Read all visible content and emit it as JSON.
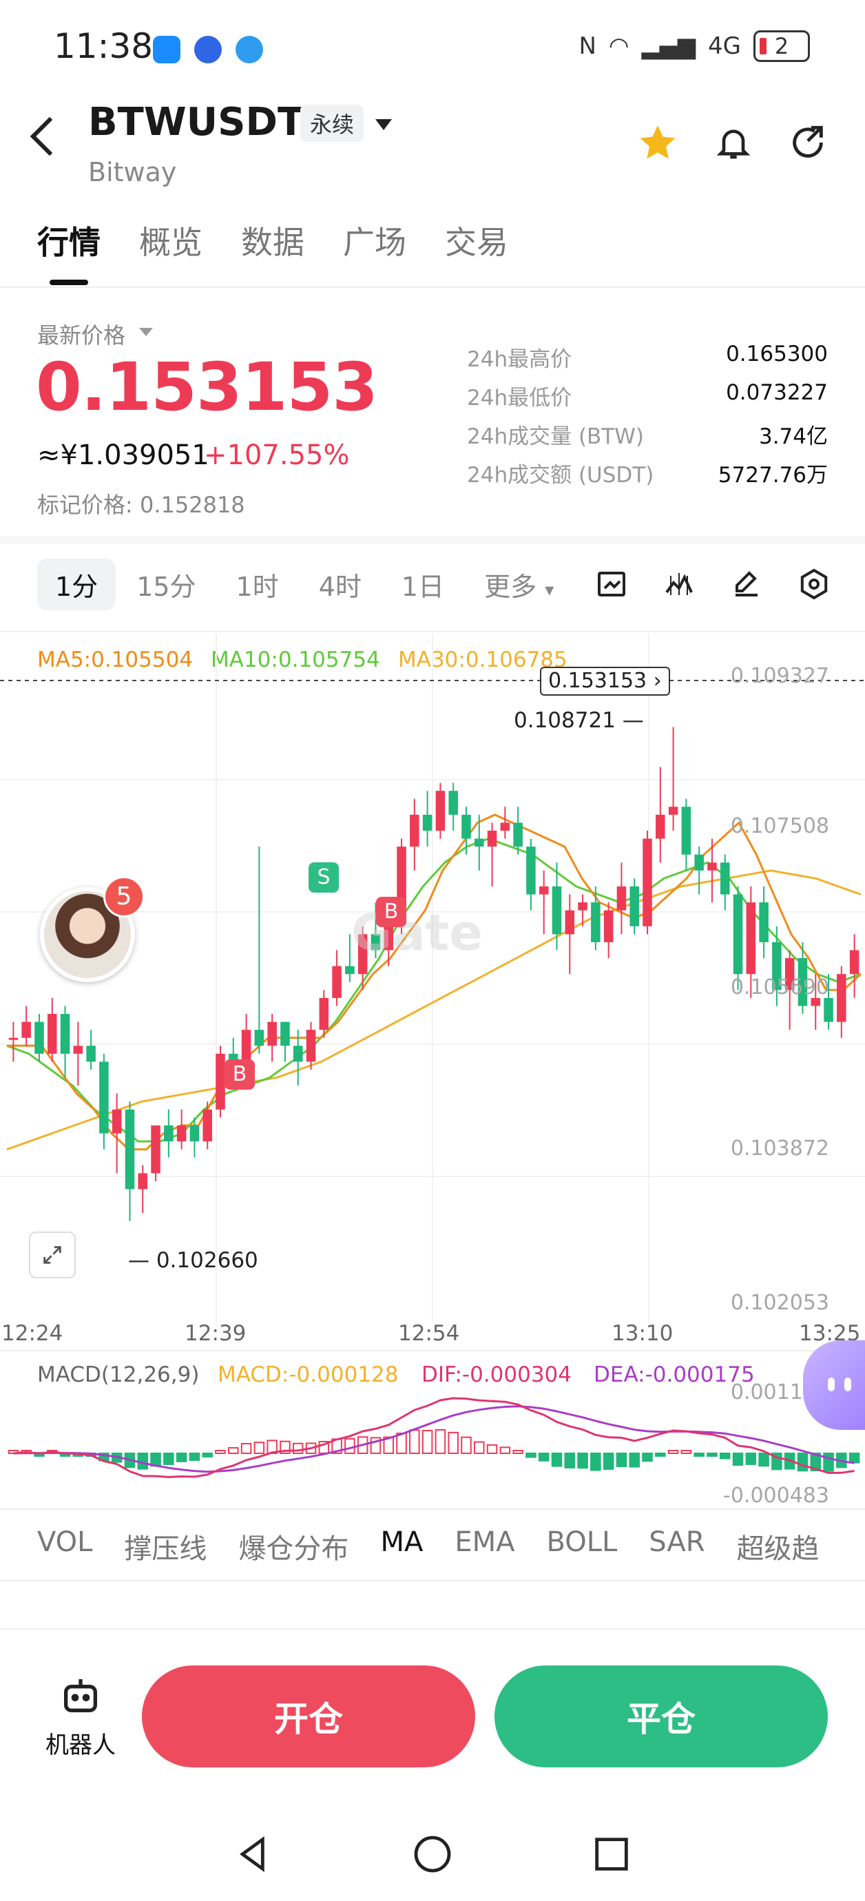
{
  "status_bar": {
    "time": "11:38",
    "battery": "2",
    "network": "4G"
  },
  "header": {
    "symbol": "BTWUSDT",
    "contract_type": "永续",
    "exchange": "Bitway",
    "favorite": true
  },
  "tabs": [
    {
      "label": "行情",
      "active": true
    },
    {
      "label": "概览"
    },
    {
      "label": "数据"
    },
    {
      "label": "广场"
    },
    {
      "label": "交易"
    }
  ],
  "price": {
    "latest_label": "最新价格",
    "last": "0.153153",
    "cny": "≈¥1.039051",
    "change": "+107.55%",
    "mark_label": "标记价格",
    "mark": "0.152818"
  },
  "stats": [
    {
      "label": "24h最高价",
      "value": "0.165300"
    },
    {
      "label": "24h最低价",
      "value": "0.073227"
    },
    {
      "label": "24h成交量 (BTW)",
      "value": "3.74亿"
    },
    {
      "label": "24h成交额 (USDT)",
      "value": "5727.76万"
    }
  ],
  "timeframes": [
    {
      "label": "1分",
      "active": true
    },
    {
      "label": "15分"
    },
    {
      "label": "1时"
    },
    {
      "label": "4时"
    },
    {
      "label": "1日"
    },
    {
      "label": "更多"
    }
  ],
  "colors": {
    "up": "#ee3b55",
    "down": "#1fb77a",
    "ma5": "#f08c18",
    "ma10": "#5ecb3a",
    "ma30": "#f2b12c",
    "dif": "#e0356f",
    "dea": "#a93cc8",
    "macd": "#f2b12c"
  },
  "chart_data": {
    "type": "candlestick",
    "legend": {
      "ma5": "MA5:0.105504",
      "ma10": "MA10:0.105754",
      "ma30": "MA30:0.106785"
    },
    "y_ticks": [
      "0.109327",
      "0.107508",
      "0.105690",
      "0.103872",
      "0.102053"
    ],
    "x_ticks": [
      "12:24",
      "12:39",
      "12:54",
      "13:10",
      "13:25"
    ],
    "ylim": [
      0.1016,
      0.1099
    ],
    "last_price_pill": "0.153153",
    "high_label": "0.108721",
    "low_label": "0.102660",
    "markers": [
      {
        "type": "S"
      },
      {
        "type": "B"
      },
      {
        "type": "B"
      }
    ],
    "candles": [
      [
        0.105,
        0.1052,
        0.1047,
        0.105
      ],
      [
        0.105,
        0.1054,
        0.1049,
        0.1052
      ],
      [
        0.1052,
        0.1053,
        0.1047,
        0.1048
      ],
      [
        0.1048,
        0.1055,
        0.1047,
        0.1053
      ],
      [
        0.1053,
        0.1054,
        0.1045,
        0.1048
      ],
      [
        0.1048,
        0.1052,
        0.1044,
        0.1049
      ],
      [
        0.1049,
        0.1051,
        0.1046,
        0.1047
      ],
      [
        0.1047,
        0.1048,
        0.1036,
        0.1038
      ],
      [
        0.1038,
        0.1043,
        0.1033,
        0.1041
      ],
      [
        0.1041,
        0.1042,
        0.1027,
        0.1031
      ],
      [
        0.1031,
        0.1034,
        0.1028,
        0.1033
      ],
      [
        0.1033,
        0.1039,
        0.1032,
        0.1039
      ],
      [
        0.1039,
        0.1041,
        0.1035,
        0.1037
      ],
      [
        0.1037,
        0.1041,
        0.1036,
        0.1039
      ],
      [
        0.1039,
        0.104,
        0.1035,
        0.1037
      ],
      [
        0.1037,
        0.1042,
        0.1036,
        0.1041
      ],
      [
        0.1041,
        0.1049,
        0.104,
        0.1048
      ],
      [
        0.1048,
        0.105,
        0.1044,
        0.1046
      ],
      [
        0.1046,
        0.1053,
        0.1045,
        0.1051
      ],
      [
        0.1051,
        0.1074,
        0.1048,
        0.1049
      ],
      [
        0.1049,
        0.1053,
        0.1047,
        0.1052
      ],
      [
        0.1052,
        0.1052,
        0.1047,
        0.1049
      ],
      [
        0.1049,
        0.1051,
        0.1044,
        0.1047
      ],
      [
        0.1047,
        0.1052,
        0.1046,
        0.1051
      ],
      [
        0.1051,
        0.1056,
        0.105,
        0.1055
      ],
      [
        0.1055,
        0.1061,
        0.1054,
        0.1059
      ],
      [
        0.1059,
        0.1063,
        0.1057,
        0.1058
      ],
      [
        0.1058,
        0.1064,
        0.1056,
        0.1063
      ],
      [
        0.1063,
        0.1067,
        0.106,
        0.1061
      ],
      [
        0.1061,
        0.1066,
        0.1059,
        0.1065
      ],
      [
        0.1065,
        0.1075,
        0.1063,
        0.1074
      ],
      [
        0.1074,
        0.108,
        0.1071,
        0.1078
      ],
      [
        0.1078,
        0.1081,
        0.1074,
        0.1076
      ],
      [
        0.1076,
        0.1082,
        0.1075,
        0.1081
      ],
      [
        0.1081,
        0.1082,
        0.1076,
        0.1078
      ],
      [
        0.1078,
        0.1079,
        0.1073,
        0.1075
      ],
      [
        0.1075,
        0.1078,
        0.1071,
        0.1074
      ],
      [
        0.1074,
        0.1077,
        0.1069,
        0.1076
      ],
      [
        0.1076,
        0.1079,
        0.1075,
        0.1077
      ],
      [
        0.1077,
        0.1079,
        0.1073,
        0.1074
      ],
      [
        0.1074,
        0.1075,
        0.1066,
        0.1068
      ],
      [
        0.1068,
        0.1071,
        0.1063,
        0.1069
      ],
      [
        0.1069,
        0.1072,
        0.1061,
        0.1063
      ],
      [
        0.1063,
        0.1068,
        0.1058,
        0.1066
      ],
      [
        0.1066,
        0.1068,
        0.1064,
        0.1067
      ],
      [
        0.1067,
        0.1069,
        0.1061,
        0.1062
      ],
      [
        0.1062,
        0.1067,
        0.106,
        0.1066
      ],
      [
        0.1066,
        0.1072,
        0.1063,
        0.1069
      ],
      [
        0.1069,
        0.107,
        0.1063,
        0.1064
      ],
      [
        0.1064,
        0.1076,
        0.1063,
        0.1075
      ],
      [
        0.1075,
        0.1084,
        0.1072,
        0.1078
      ],
      [
        0.1078,
        0.1089,
        0.1076,
        0.1079
      ],
      [
        0.1079,
        0.108,
        0.1071,
        0.1073
      ],
      [
        0.1073,
        0.1074,
        0.1068,
        0.1071
      ],
      [
        0.1071,
        0.1075,
        0.1067,
        0.1072
      ],
      [
        0.1072,
        0.1073,
        0.1066,
        0.1068
      ],
      [
        0.1068,
        0.1069,
        0.1056,
        0.1058
      ],
      [
        0.1058,
        0.1069,
        0.1055,
        0.1067
      ],
      [
        0.1067,
        0.1069,
        0.106,
        0.1062
      ],
      [
        0.1062,
        0.1064,
        0.1054,
        0.1056
      ],
      [
        0.1056,
        0.1061,
        0.1051,
        0.106
      ],
      [
        0.106,
        0.1062,
        0.1053,
        0.1054
      ],
      [
        0.1054,
        0.1058,
        0.1051,
        0.1055
      ],
      [
        0.1055,
        0.1058,
        0.1051,
        0.1052
      ],
      [
        0.1052,
        0.1059,
        0.105,
        0.1058
      ],
      [
        0.1058,
        0.1063,
        0.1055,
        0.1061
      ]
    ],
    "ma5": [
      0.1049,
      0.1049,
      0.1049,
      0.1046,
      0.1043,
      0.1041,
      0.1038,
      0.1036,
      0.1036,
      0.1038,
      0.1039,
      0.1039,
      0.1043,
      0.1045,
      0.1048,
      0.105,
      0.105,
      0.105,
      0.105,
      0.1052,
      0.1055,
      0.1058,
      0.106,
      0.1063,
      0.1066,
      0.1071,
      0.1074,
      0.1077,
      0.1078,
      0.1077,
      0.1076,
      0.1075,
      0.1074,
      0.107,
      0.1067,
      0.1066,
      0.1065,
      0.1066,
      0.1068,
      0.107,
      0.1073,
      0.1075,
      0.1077,
      0.1073,
      0.1068,
      0.1063,
      0.106,
      0.1056,
      0.1056,
      0.1058
    ],
    "ma10": [
      0.1049,
      0.1048,
      0.1046,
      0.1044,
      0.1041,
      0.1039,
      0.1037,
      0.1037,
      0.1038,
      0.1041,
      0.1043,
      0.1044,
      0.1045,
      0.1047,
      0.1049,
      0.1052,
      0.1056,
      0.106,
      0.1065,
      0.1069,
      0.1072,
      0.1074,
      0.1075,
      0.1074,
      0.1073,
      0.1071,
      0.1069,
      0.1068,
      0.1067,
      0.1068,
      0.107,
      0.1071,
      0.1072,
      0.107,
      0.1066,
      0.1063,
      0.106,
      0.1058,
      0.1057,
      0.1058
    ],
    "ma30": [
      0.1036,
      0.1038,
      0.104,
      0.1042,
      0.1043,
      0.1044,
      0.1045,
      0.1047,
      0.105,
      0.1053,
      0.1056,
      0.1059,
      0.1062,
      0.1065,
      0.1067,
      0.1069,
      0.107,
      0.1071,
      0.107,
      0.1068
    ]
  },
  "macd": {
    "legend": {
      "title": "MACD(12,26,9)",
      "macd": "MACD:-0.000128",
      "dif": "DIF:-0.000304",
      "dea": "DEA:-0.000175"
    },
    "y_ticks": [
      "0.001147",
      "-0.000483"
    ]
  },
  "indicator_tabs": [
    {
      "label": "VOL"
    },
    {
      "label": "撑压线"
    },
    {
      "label": "爆仓分布"
    },
    {
      "label": "MA",
      "active": true
    },
    {
      "label": "EMA"
    },
    {
      "label": "BOLL"
    },
    {
      "label": "SAR"
    },
    {
      "label": "超级趋"
    }
  ],
  "bottom": {
    "robot_label": "机器人",
    "open_label": "开仓",
    "close_label": "平仓"
  },
  "badges": {
    "avatar_notifications": "5"
  },
  "watermark": "Gate"
}
